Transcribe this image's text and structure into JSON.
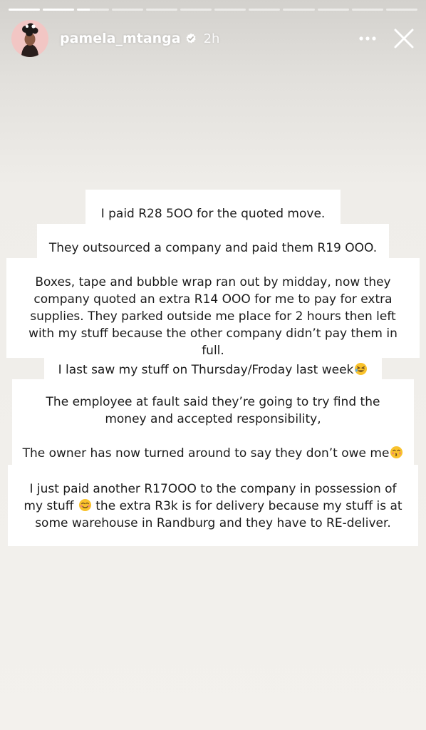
{
  "story": {
    "segments": [
      1,
      1,
      0.4,
      0,
      0,
      0,
      0,
      0,
      0,
      0,
      0,
      0
    ]
  },
  "header": {
    "username": "pamela_mtanga",
    "time": "2h",
    "verified": true
  },
  "icons": {
    "more": "more-horizontal-icon",
    "close": "close-icon",
    "verified": "verified-badge-icon"
  },
  "lines": {
    "l1": "I paid R28 5OO for the quoted move.",
    "l2": "They outsourced a company and paid them R19 OOO.",
    "l3": "Boxes, tape and bubble wrap ran out by midday, now they company quoted an extra R14 OOO for me to pay for extra supplies. They parked outside me place for 2 hours then left with my stuff because the other company didn’t pay them in full.",
    "l4": "I last saw my stuff on Thursday/Froday last week",
    "l5": "The employee at fault said they’re going to try find the money and accepted responsibility,",
    "l6": "The owner has now turned around to say they don’t owe me",
    "l7a": "I just paid another R17OOO to the company in possession of my stuff",
    "l7b": "the extra R3k is for delivery because my stuff is at some warehouse in Randburg and they have to RE-deliver."
  }
}
